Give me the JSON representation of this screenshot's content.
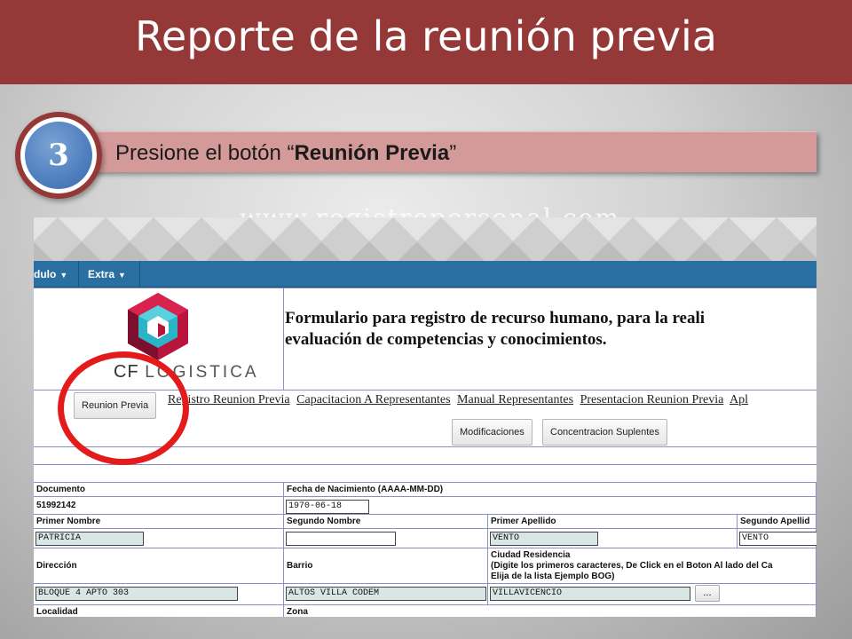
{
  "slide": {
    "title": "Reporte de la reunión previa",
    "step_number": "3",
    "step_text_prefix": "Presione el botón “",
    "step_text_bold": "Reunión Previa",
    "step_text_suffix": "”",
    "watermark": "www.registropersonal.com"
  },
  "app": {
    "menu": [
      {
        "label": "dulo"
      },
      {
        "label": "Extra"
      }
    ],
    "logo": {
      "brand": "CF",
      "name": "LOGISTICA"
    },
    "form_title_line1": "Formulario para registro de recurso humano, para la reali",
    "form_title_line2": "evaluación de competencias y conocimientos.",
    "buttons": {
      "reunion_previa": "Reunion Previa",
      "modificaciones": "Modificaciones",
      "concentracion": "Concentracion Suplentes",
      "dots": "..."
    },
    "links": [
      "Registro Reunion Previa",
      "Capacitacion A Representantes",
      "Manual Representantes",
      "Presentacion Reunion Previa",
      "Apl"
    ],
    "fields": {
      "documento_label": "Documento",
      "documento_value": "51992142",
      "fecha_label": "Fecha de Nacimiento (AAAA-MM-DD)",
      "fecha_value": "1970-06-18",
      "primer_nombre_label": "Primer Nombre",
      "primer_nombre_value": "PATRICIA",
      "segundo_nombre_label": "Segundo Nombre",
      "segundo_nombre_value": "",
      "primer_apellido_label": "Primer Apellido",
      "primer_apellido_value": "VENTO",
      "segundo_apellido_label": "Segundo Apellid",
      "segundo_apellido_value": "VENTO",
      "direccion_label": "Dirección",
      "direccion_value": "BLOQUE 4 APTO 303",
      "barrio_label": "Barrio",
      "barrio_value": "ALTOS VILLA CODEM",
      "ciudad_label": "Ciudad Residencia",
      "ciudad_hint1": "(Digite los primeros caracteres, De Click en el Boton Al lado del Ca",
      "ciudad_hint2": "Elija de la lista Ejemplo BOG)",
      "ciudad_value": "VILLAVICENCIO",
      "localidad_label": "Localidad",
      "zona_label": "Zona"
    }
  },
  "colors": {
    "banner": "#943838",
    "step_bar": "#d49a9a",
    "step_circle": "#4f7fbf",
    "menubar": "#2a6fa1",
    "highlight_circle": "#e41b1b"
  }
}
